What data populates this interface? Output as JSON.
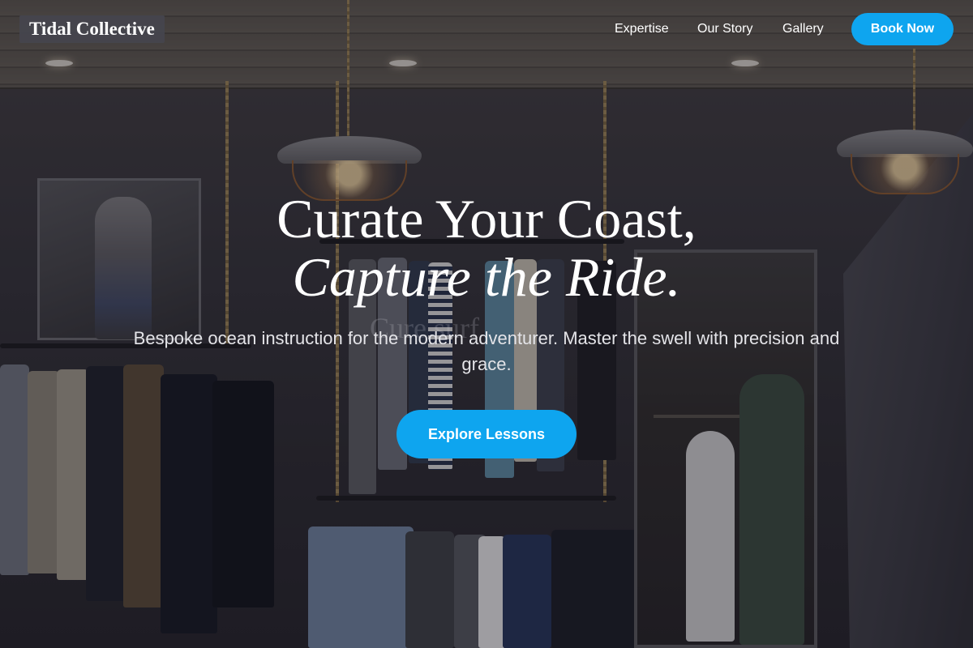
{
  "nav": {
    "logo": "Tidal Collective",
    "links": [
      "Expertise",
      "Our Story",
      "Gallery"
    ],
    "cta_label": "Book Now"
  },
  "hero": {
    "headline_line1": "Curate Your Coast,",
    "headline_line2": "Capture the Ride.",
    "subheading": "Bespoke ocean instruction for the modern adventurer. Master the swell with precision and grace.",
    "cta_label": "Explore Lessons",
    "background_watermark": "Cure surf"
  },
  "colors": {
    "accent": "#0ea5ef",
    "logo_bg": "#46464e",
    "text": "#ffffff"
  }
}
